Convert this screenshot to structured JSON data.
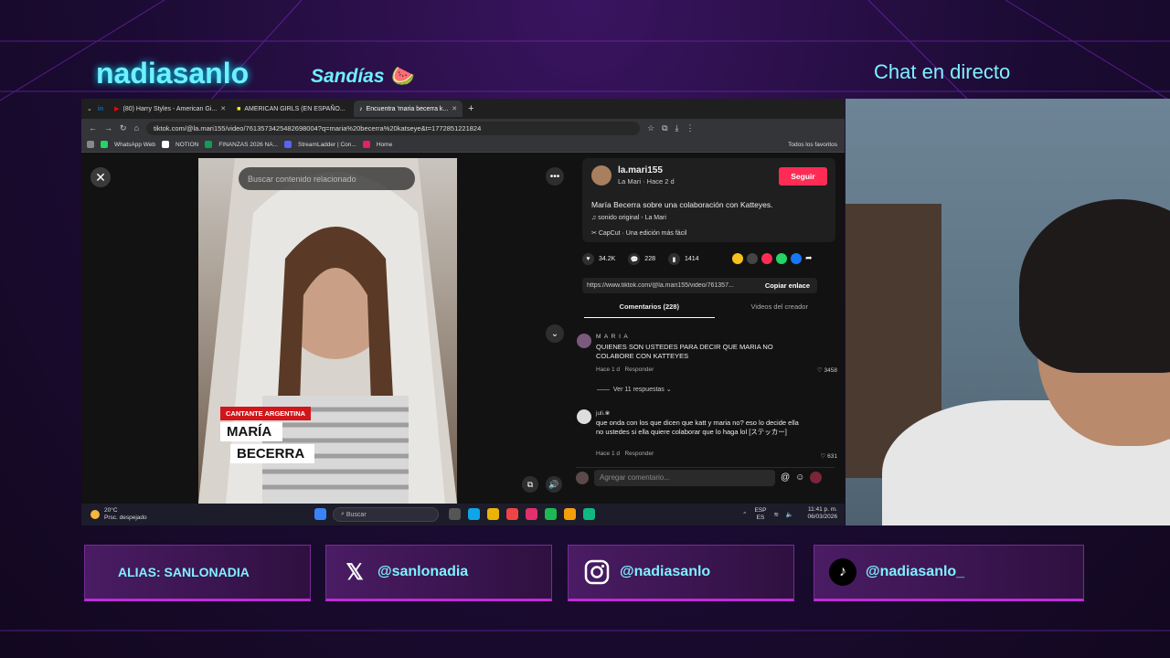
{
  "overlay": {
    "streamer_name": "nadiasanlo",
    "team_name": "Sandías 🍉",
    "chat_title": "Chat en directo",
    "socials": [
      {
        "label": "ALIAS: SANLONADIA",
        "icon": ""
      },
      {
        "label": "@sanlonadia",
        "icon": "x-icon"
      },
      {
        "label": "@nadiasanlo",
        "icon": "instagram-icon"
      },
      {
        "label": "@nadiasanlo_",
        "icon": "tiktok-icon"
      }
    ]
  },
  "browser": {
    "tabs": [
      {
        "label": "(80) Harry Styles - American Gi...",
        "active": false
      },
      {
        "label": "AMERICAN GIRLS (EN ESPAÑO...",
        "active": false
      },
      {
        "label": "Encuentra 'maria becerra k...",
        "active": true
      }
    ],
    "url": "tiktok.com/@la.mari155/video/7613573425482698004?q=maria%20becerra%20katseye&t=1772851221824",
    "bookmarks": [
      "WhatsApp Web",
      "NOTION",
      "FINANZAS 2026 NA...",
      "StreamLadder | Con...",
      "Home"
    ],
    "all_bookmarks": "Todos los favoritos"
  },
  "tiktok": {
    "search_placeholder": "Buscar contenido relacionado",
    "video_tag": "CANTANTE ARGENTINA",
    "video_name_1": "MARÍA",
    "video_name_2": "BECERRA",
    "username": "la.mari155",
    "user_sub": "La Mari · Hace 2 d",
    "follow_label": "Seguir",
    "description": "María Becerra sobre una colaboración con Katteyes.",
    "sound": "sonido original - La Mari",
    "capcut": "CapCut · Una edición más fácil",
    "likes": "34.2K",
    "comments_count": "228",
    "saves": "1414",
    "share_link": "https://www.tiktok.com/@la.mari155/video/761357...",
    "copy_label": "Copiar enlace",
    "tab_comments": "Comentarios (228)",
    "tab_videos": "Videos del creador",
    "comments": [
      {
        "user": "M A R I A",
        "text": "QUIENES SON USTEDES PARA DECIR QUE MARIA NO COLABORE CON KATTEYES",
        "time": "Hace 1 d",
        "reply": "Responder",
        "likes": "3458"
      },
      {
        "user": "juli.❀",
        "text": "que onda con los que dicen que katt y maria no? eso lo decide ella no ustedes si ella quiere colaborar que lo haga lol [ステッカー]",
        "time": "Hace 1 d",
        "reply": "Responder",
        "likes": "631"
      }
    ],
    "view_replies": "Ver 11 respuestas",
    "comment_placeholder": "Agregar comentario..."
  },
  "taskbar": {
    "temp": "20°C",
    "weather": "Prsc. despejado",
    "search": "Buscar",
    "lang1": "ESP",
    "lang2": "ES",
    "time": "11:41 p. m.",
    "date": "06/03/2026"
  }
}
